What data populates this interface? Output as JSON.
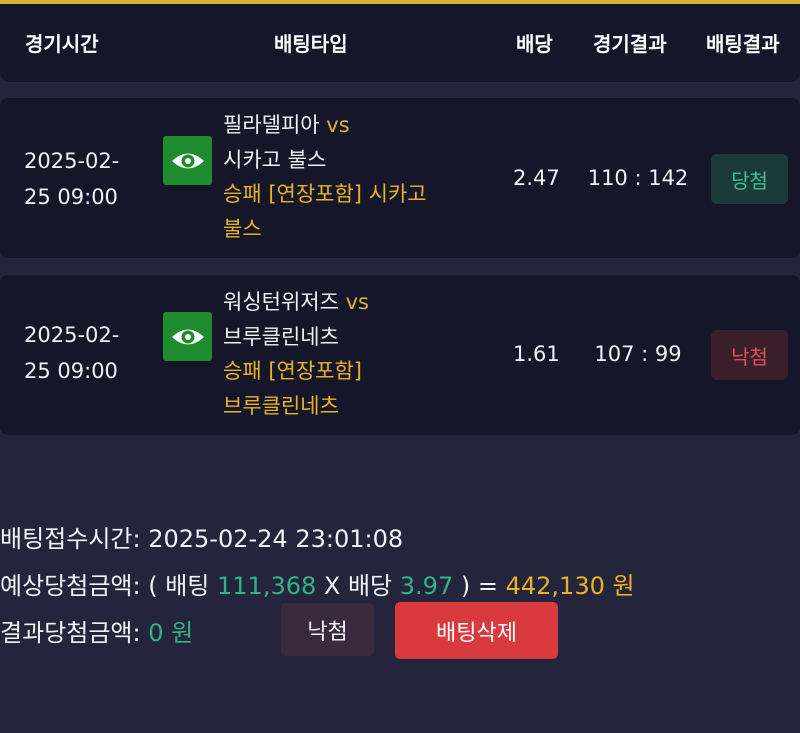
{
  "header": {
    "col_time": "경기시간",
    "col_type": "배팅타입",
    "col_odds": "배당",
    "col_score": "경기결과",
    "col_result": "배팅결과"
  },
  "bets": [
    {
      "date": "2025-02-",
      "time": "25 09:00",
      "icon": "eye-icon",
      "home": "필라델피아",
      "vs": "vs",
      "away": "시카고 불스",
      "pick_line1": "승패 [연장포함] 시카고",
      "pick_line2": "불스",
      "odds": "2.47",
      "score": "110 : 142",
      "result": "당첨"
    },
    {
      "date": "2025-02-",
      "time": "25 09:00",
      "icon": "eye-icon",
      "home": "워싱턴위저즈",
      "vs": "vs",
      "away": "브루클린네츠",
      "pick_line1": "승패 [연장포함]",
      "pick_line2": "브루클린네츠",
      "odds": "1.61",
      "score": "107 : 99",
      "result": "낙첨"
    }
  ],
  "summary": {
    "received_label": "배팅접수시간:",
    "received_value": "2025-02-24 23:01:08",
    "expected_label": "예상당첨금액:",
    "expected_open": "( 배팅",
    "stake": "111,368",
    "times": "X 배당",
    "total_odds": "3.97",
    "expected_close": ") =",
    "expected_amount": "442,130 원",
    "result_label": "결과당첨금액:",
    "result_amount": "0 원"
  },
  "actions": {
    "status_label": "낙첨",
    "delete_label": "배팅삭제"
  },
  "colors": {
    "background": "#24243c",
    "panel": "#15162a",
    "accent_gold": "#e7b320",
    "win": "#3fbf9a",
    "lose": "#e0505a",
    "delete": "#d83a3e"
  }
}
